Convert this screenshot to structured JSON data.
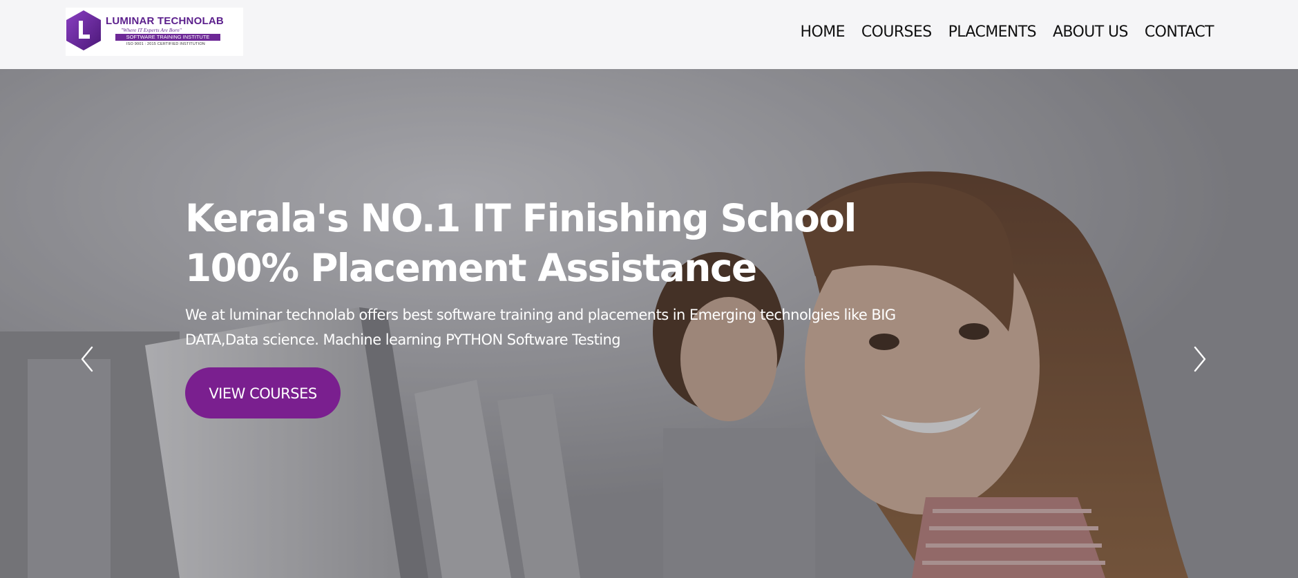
{
  "logo": {
    "name": "LUMINAR TECHNOLAB",
    "tagline": "\"Where IT Experts Are Born\"",
    "band": "SOFTWARE TRAINING INSTITUTE",
    "iso": "ISO 9001 : 2015 CERTIFIED INSTITUTION",
    "letter": "L"
  },
  "nav": {
    "items": [
      "HOME",
      "COURSES",
      "PLACMENTS",
      "ABOUT US",
      "CONTACT"
    ]
  },
  "hero": {
    "title_line1": "Kerala's NO.1 IT Finishing School",
    "title_line2": "100% Placement Assistance",
    "description": "We at luminar technolab offers best software training and placements in Emerging technolgies like BIG DATA,Data science. Machine learning PYTHON Software Testing",
    "button_label": "VIEW COURSES",
    "prev_icon": "chevron-left-icon",
    "next_icon": "chevron-right-icon"
  },
  "colors": {
    "brand_purple": "#5b1f8c",
    "button_purple": "#7a1f8f",
    "header_bg": "#f5f5f7",
    "text_white": "#ffffff"
  }
}
